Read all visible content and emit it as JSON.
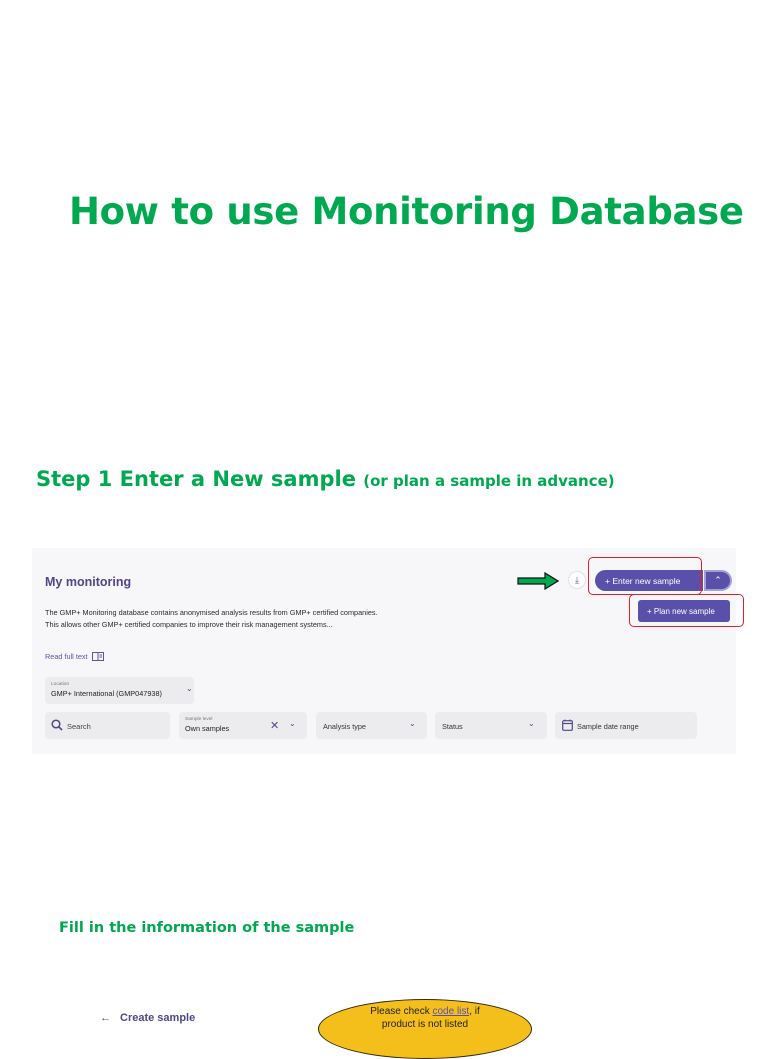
{
  "page": {
    "title": "How to use Monitoring Database",
    "step_heading": "Step 1 Enter a New sample",
    "step_note": "(or plan a sample in advance)",
    "fill_heading": "Fill in the information of the sample"
  },
  "colors": {
    "heading_green": "#00a84f",
    "brand_purple": "#5a50a9",
    "highlight_red": "#e0202a",
    "callout_yellow": "#f5bf1b"
  },
  "monitoring": {
    "title": "My monitoring",
    "description": "The GMP+ Monitoring database contains anonymised analysis results from GMP+ certified companies. This allows other GMP+ certified companies to improve their risk management systems...",
    "read_full_text": "Read full text",
    "read_full_icon": "reader-icon",
    "download_icon": "download-icon",
    "enter_button": "+ Enter new sample",
    "caret_icon": "chevron-up-icon",
    "plan_button": "+ Plan new sample",
    "location": {
      "label": "Location",
      "value": "GMP+ International (GMP047938)"
    },
    "filters": {
      "search_placeholder": "Search",
      "sample_level_label": "Sample level",
      "sample_level_value": "Own samples",
      "analysis_type": "Analysis type",
      "status": "Status",
      "date_range": "Sample date range"
    }
  },
  "create_sample": {
    "back_label": "Create sample",
    "callout_text_1": "Please check",
    "callout_link": "code list",
    "callout_text_2": ", if",
    "callout_text_3": "product is not listed"
  }
}
